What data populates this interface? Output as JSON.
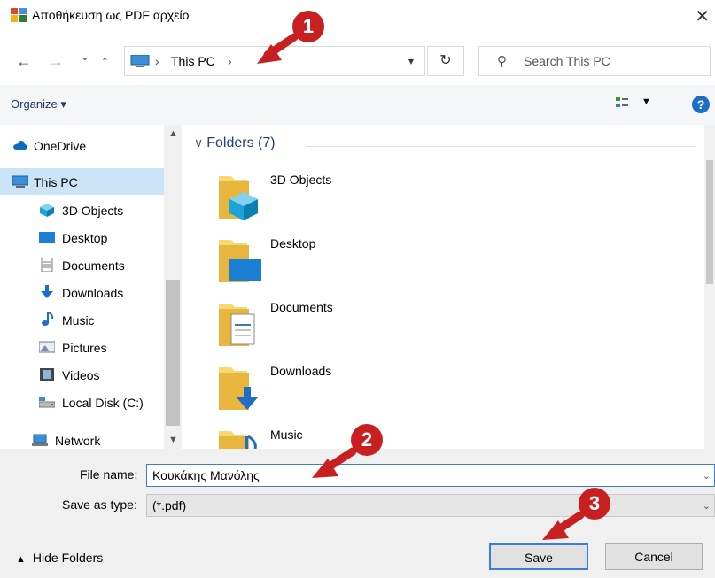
{
  "window": {
    "title": "Αποθήκευση ως PDF αρχείο",
    "close_glyph": "✕"
  },
  "address": {
    "back_glyph": "←",
    "forward_glyph": "→",
    "recent_glyph": "⌄",
    "up_glyph": "↑",
    "crumbs": [
      "This PC"
    ],
    "sep": "›",
    "refresh_glyph": "↻",
    "search_placeholder": "Search This PC"
  },
  "toolbar": {
    "organize": "Organize ▾",
    "help": "?"
  },
  "sidebar": {
    "items": [
      {
        "label": "OneDrive",
        "icon": "cloud-icon"
      },
      {
        "label": "This PC",
        "icon": "computer-icon",
        "selected": true
      },
      {
        "label": "3D Objects",
        "icon": "cube-icon"
      },
      {
        "label": "Desktop",
        "icon": "desktop-icon"
      },
      {
        "label": "Documents",
        "icon": "document-icon"
      },
      {
        "label": "Downloads",
        "icon": "download-icon"
      },
      {
        "label": "Music",
        "icon": "music-icon"
      },
      {
        "label": "Pictures",
        "icon": "pictures-icon"
      },
      {
        "label": "Videos",
        "icon": "video-icon"
      },
      {
        "label": "Local Disk (C:)",
        "icon": "disk-icon"
      },
      {
        "label": "Network",
        "icon": "network-icon"
      }
    ]
  },
  "main": {
    "group_header": "Folders (7)",
    "folders": [
      {
        "name": "3D Objects",
        "icon": "folder-3d-icon"
      },
      {
        "name": "Desktop",
        "icon": "folder-desktop-icon"
      },
      {
        "name": "Documents",
        "icon": "folder-documents-icon"
      },
      {
        "name": "Downloads",
        "icon": "folder-downloads-icon"
      },
      {
        "name": "Music",
        "icon": "folder-music-icon"
      }
    ]
  },
  "form": {
    "file_name_label": "File name:",
    "file_name_value": "Κουκάκης Μανόλης",
    "save_type_label": "Save as type:",
    "save_type_value": "(*.pdf)",
    "hide_folders": "Hide Folders",
    "save_button": "Save",
    "cancel_button": "Cancel"
  },
  "annotations": {
    "markers": [
      "1",
      "2",
      "3"
    ],
    "color": "#c82020"
  }
}
